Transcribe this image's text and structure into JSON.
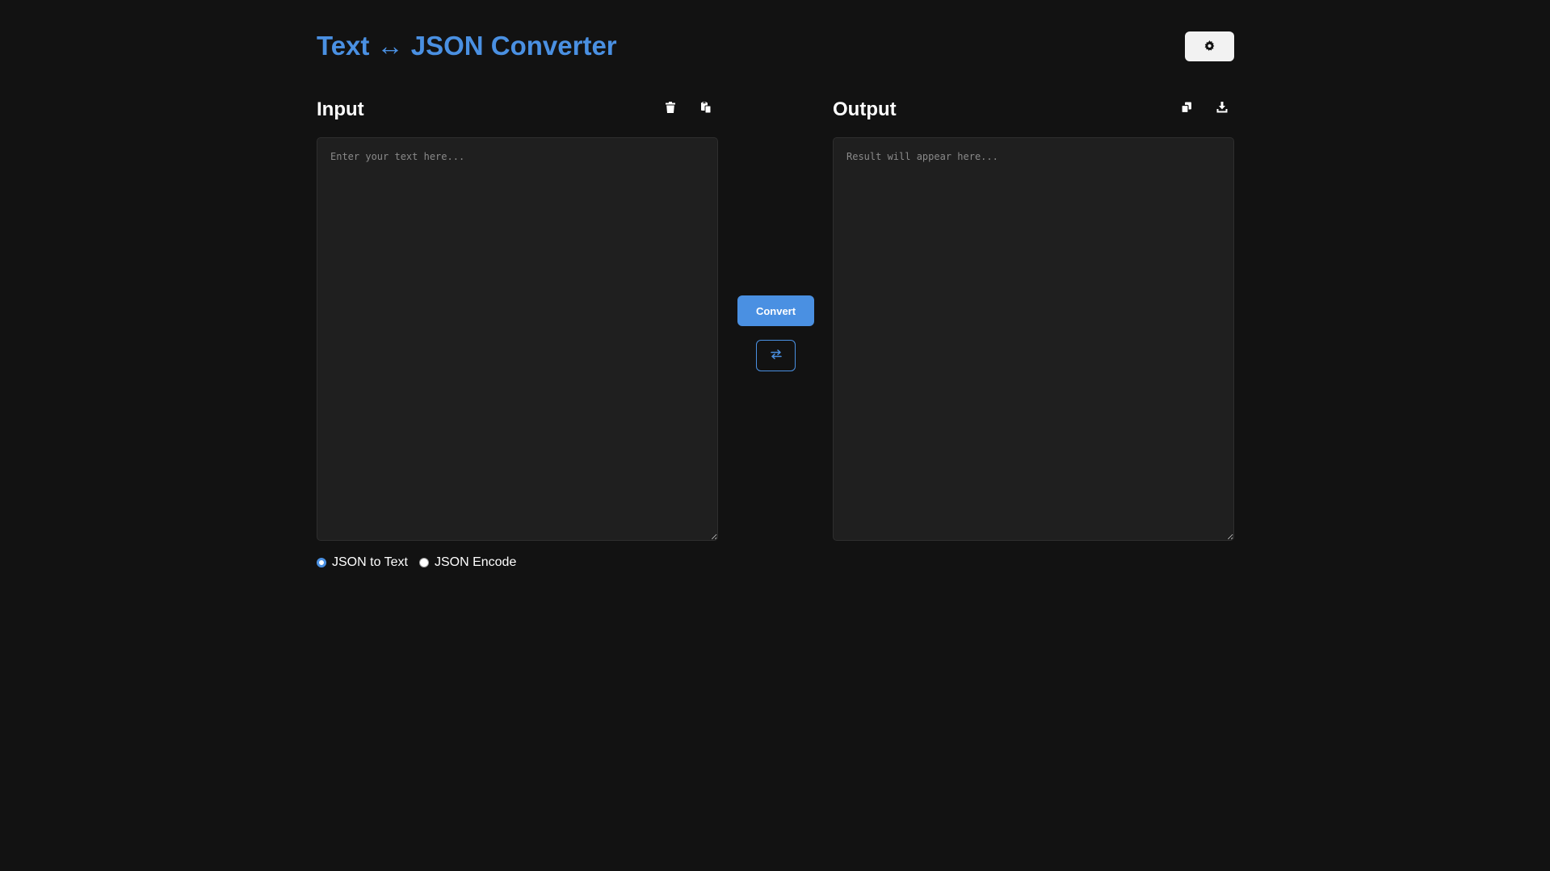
{
  "header": {
    "title": "Text ↔ JSON Converter",
    "theme_toggle_icon": "gear-icon"
  },
  "input_panel": {
    "title": "Input",
    "placeholder": "Enter your text here...",
    "value": "",
    "actions": [
      {
        "name": "clear",
        "icon": "trash-icon"
      },
      {
        "name": "paste",
        "icon": "paste-icon"
      }
    ]
  },
  "output_panel": {
    "title": "Output",
    "placeholder": "Result will appear here...",
    "value": "",
    "actions": [
      {
        "name": "copy",
        "icon": "copy-icon"
      },
      {
        "name": "download",
        "icon": "download-icon"
      }
    ]
  },
  "controls": {
    "convert_label": "Convert",
    "swap_icon": "swap-arrows-icon"
  },
  "modes": {
    "options": [
      {
        "label": "JSON to Text",
        "selected": true
      },
      {
        "label": "JSON Encode",
        "selected": false
      }
    ]
  },
  "colors": {
    "background": "#121212",
    "accent": "#4a90e2",
    "panel": "#1f1f1f"
  }
}
